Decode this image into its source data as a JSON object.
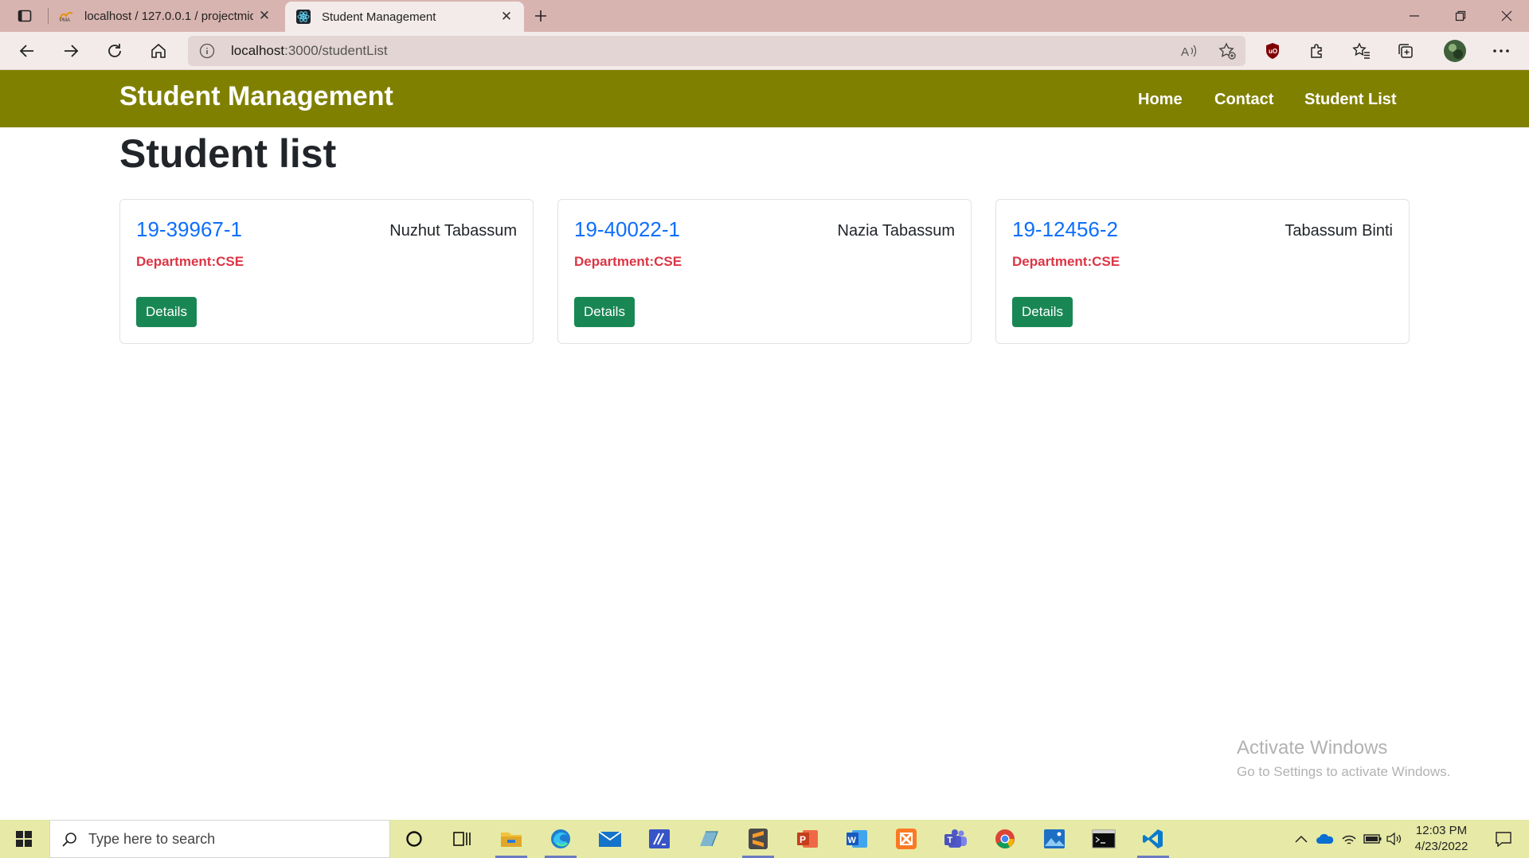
{
  "browser": {
    "tabs": [
      {
        "title": "localhost / 127.0.0.1 / projectmid",
        "active": false,
        "favicon": "phpmyadmin-icon"
      },
      {
        "title": "Student Management",
        "active": true,
        "favicon": "react-icon"
      }
    ],
    "address": {
      "host": "localhost",
      "path": ":3000/studentList"
    }
  },
  "navbar": {
    "brand": "Student Management",
    "links": [
      "Home",
      "Contact",
      "Student List"
    ],
    "background": "#808000"
  },
  "page": {
    "title": "Student list",
    "students": [
      {
        "id": "19-39967-1",
        "name": "Nuzhut Tabassum",
        "department": "Department:CSE",
        "button": "Details"
      },
      {
        "id": "19-40022-1",
        "name": "Nazia Tabassum",
        "department": "Department:CSE",
        "button": "Details"
      },
      {
        "id": "19-12456-2",
        "name": "Tabassum Binti",
        "department": "Department:CSE",
        "button": "Details"
      }
    ]
  },
  "watermark": {
    "title": "Activate Windows",
    "subtitle": "Go to Settings to activate Windows."
  },
  "taskbar": {
    "search_placeholder": "Type here to search",
    "time": "12:03 PM",
    "date": "4/23/2022"
  },
  "colors": {
    "link": "#0d6efd",
    "danger": "#dc3545",
    "success": "#198754"
  }
}
